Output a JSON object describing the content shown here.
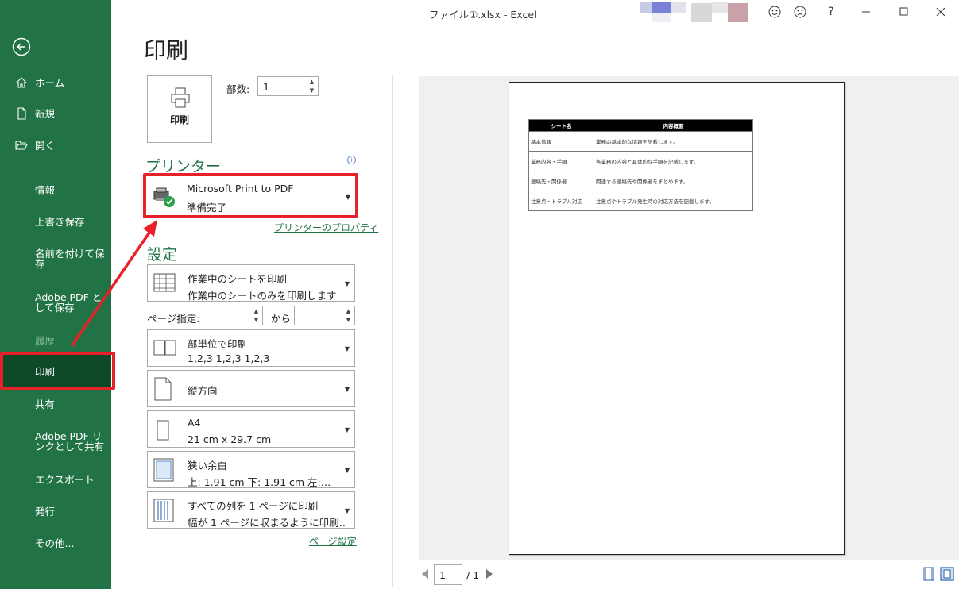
{
  "window": {
    "title": "ファイル①.xlsx  -  Excel",
    "help": "?"
  },
  "sidebar": {
    "items": [
      {
        "label": "ホーム"
      },
      {
        "label": "新規"
      },
      {
        "label": "開く"
      },
      {
        "label": "情報"
      },
      {
        "label": "上書き保存"
      },
      {
        "label": "名前を付けて保存"
      },
      {
        "label": "Adobe PDF として保存"
      },
      {
        "label": "履歴"
      },
      {
        "label": "印刷"
      },
      {
        "label": "共有"
      },
      {
        "label": "Adobe PDF リンクとして共有"
      },
      {
        "label": "エクスポート"
      },
      {
        "label": "発行"
      },
      {
        "label": "その他..."
      }
    ]
  },
  "print": {
    "heading": "印刷",
    "print_button": "印刷",
    "copies_label": "部数:",
    "copies_value": "1",
    "printer_heading": "プリンター",
    "printer_name": "Microsoft Print to PDF",
    "printer_status": "準備完了",
    "printer_properties": "プリンターのプロパティ",
    "settings_heading": "設定",
    "page_range_label": "ページ指定:",
    "page_range_to": "から",
    "page_setup_link": "ページ設定"
  },
  "settings": {
    "scope": {
      "title": "作業中のシートを印刷",
      "sub": "作業中のシートのみを印刷します"
    },
    "collate": {
      "title": "部単位で印刷",
      "sub": "1,2,3    1,2,3    1,2,3"
    },
    "orientation": {
      "title": "縦方向"
    },
    "paper": {
      "title": "A4",
      "sub": "21 cm x 29.7 cm"
    },
    "margins": {
      "title": "狭い余白",
      "sub": "上: 1.91 cm 下: 1.91 cm 左:…"
    },
    "scaling": {
      "title": "すべての列を 1 ページに印刷",
      "sub": "幅が 1 ページに収まるように印刷…"
    }
  },
  "preview": {
    "table": {
      "headers": [
        "シート名",
        "内容概要"
      ],
      "rows": [
        [
          "基本情報",
          "業務の基本的な情報を記載します。"
        ],
        [
          "業務内容・手順",
          "各業務の内容と具体的な手順を記載します。"
        ],
        [
          "連絡先・関係者",
          "関連する連絡先や関係者をまとめます。"
        ],
        [
          "注意点・トラブル対応",
          "注意点やトラブル発生時の対応方法を記載します。"
        ]
      ]
    },
    "page_current": "1",
    "page_total": "/ 1"
  },
  "colors": {
    "sidebar": "#217346",
    "sidebar_active": "#0e4a2a",
    "highlight": "#e8202a"
  }
}
